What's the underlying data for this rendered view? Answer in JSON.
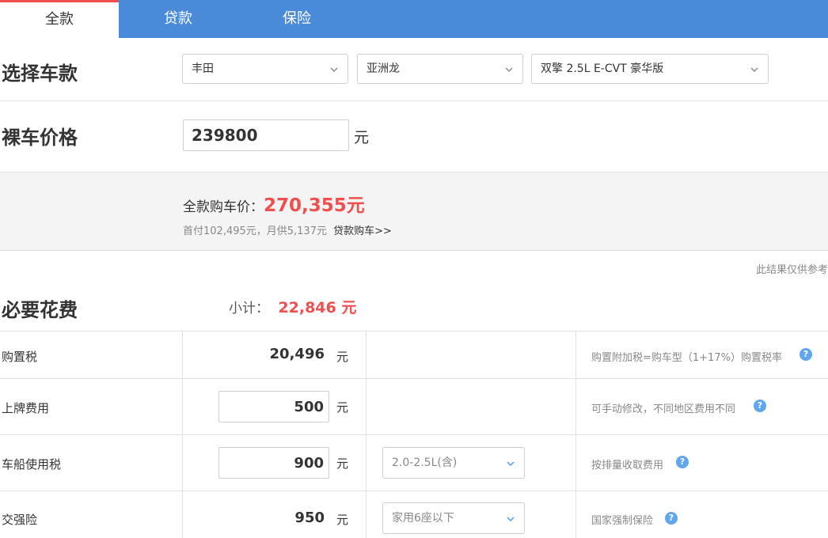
{
  "tabs": [
    "全款",
    "贷款",
    "保险"
  ],
  "select_model": {
    "title": "选择车款",
    "brand": "丰田",
    "series": "亚洲龙",
    "trim": "双擎 2.5L E-CVT 豪华版"
  },
  "bare_price": {
    "title": "裸车价格",
    "value": "239800",
    "unit": "元"
  },
  "summary": {
    "label": "全款购车价：",
    "total": "270,355元",
    "sub": "首付102,495元，月供5,137元",
    "loan_link": "贷款购车>>"
  },
  "disclaimer": "此结果仅供参考",
  "required": {
    "title": "必要花费",
    "subtotal_label": "小计：",
    "subtotal_value": "22,846 元",
    "rows": [
      {
        "label": "购置税",
        "value": "20,496",
        "unit": "元",
        "option": "",
        "note": "购置附加税=购车型（1+17%）购置税率"
      },
      {
        "label": "上牌费用",
        "value": "500",
        "unit": "元",
        "option": "",
        "note": "可手动修改，不同地区费用不同"
      },
      {
        "label": "车船使用税",
        "value": "900",
        "unit": "元",
        "option": "2.0-2.5L(含)",
        "note": "按排量收取费用"
      },
      {
        "label": "交强险",
        "value": "950",
        "unit": "元",
        "option": "家用6座以下",
        "note": "国家强制保险"
      }
    ]
  },
  "colors": {
    "tab_bar": "#4a8bd9",
    "accent_red": "#ef4f4f",
    "help_icon": "#5fa6ee"
  }
}
